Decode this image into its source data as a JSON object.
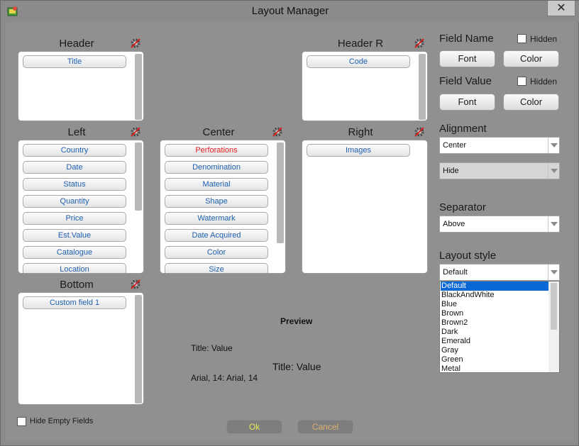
{
  "window": {
    "title": "Layout Manager",
    "close_glyph": "✕"
  },
  "header": {
    "label": "Header",
    "items": [
      "Title"
    ]
  },
  "header_r": {
    "label": "Header R",
    "items": [
      "Code"
    ]
  },
  "left": {
    "label": "Left",
    "items": [
      "Country",
      "Date",
      "Status",
      "Quantity",
      "Price",
      "Est.Value",
      "Catalogue",
      "Location"
    ]
  },
  "center": {
    "label": "Center",
    "items": [
      "Perforations",
      "Denomination",
      "Material",
      "Shape",
      "Watermark",
      "Date Acquired",
      "Color",
      "Size"
    ],
    "highlight_color": "#e21d1d"
  },
  "right": {
    "label": "Right",
    "items": [
      "Images"
    ]
  },
  "bottom": {
    "label": "Bottom",
    "items": [
      "Custom field 1"
    ]
  },
  "field_name": {
    "label": "Field Name",
    "hidden_label": "Hidden",
    "font_button": "Font",
    "color_button": "Color"
  },
  "field_value": {
    "label": "Field Value",
    "hidden_label": "Hidden",
    "font_button": "Font",
    "color_button": "Color"
  },
  "alignment": {
    "label": "Alignment",
    "value": "Center",
    "second_value": "Hide"
  },
  "separator": {
    "label": "Separator",
    "value": "Above"
  },
  "layout_style": {
    "label": "Layout style",
    "value": "Default",
    "options": [
      "Default",
      "BlackAndWhite",
      "Blue",
      "Brown",
      "Brown2",
      "Dark",
      "Emerald",
      "Gray",
      "Green",
      "Metal"
    ]
  },
  "preview": {
    "label": "Preview",
    "line1": "Title: Value",
    "line2": "Title: Value",
    "line3": "Arial, 14: Arial, 14"
  },
  "hide_empty": {
    "label": "Hide Empty Fields"
  },
  "footer": {
    "ok_label": "Ok",
    "cancel_label": "Cancel",
    "ok_color": "#e8e85a",
    "cancel_color": "#e0b070"
  },
  "colors": {
    "item_text": "#1c5fb0",
    "selection": "#0a68d6"
  }
}
